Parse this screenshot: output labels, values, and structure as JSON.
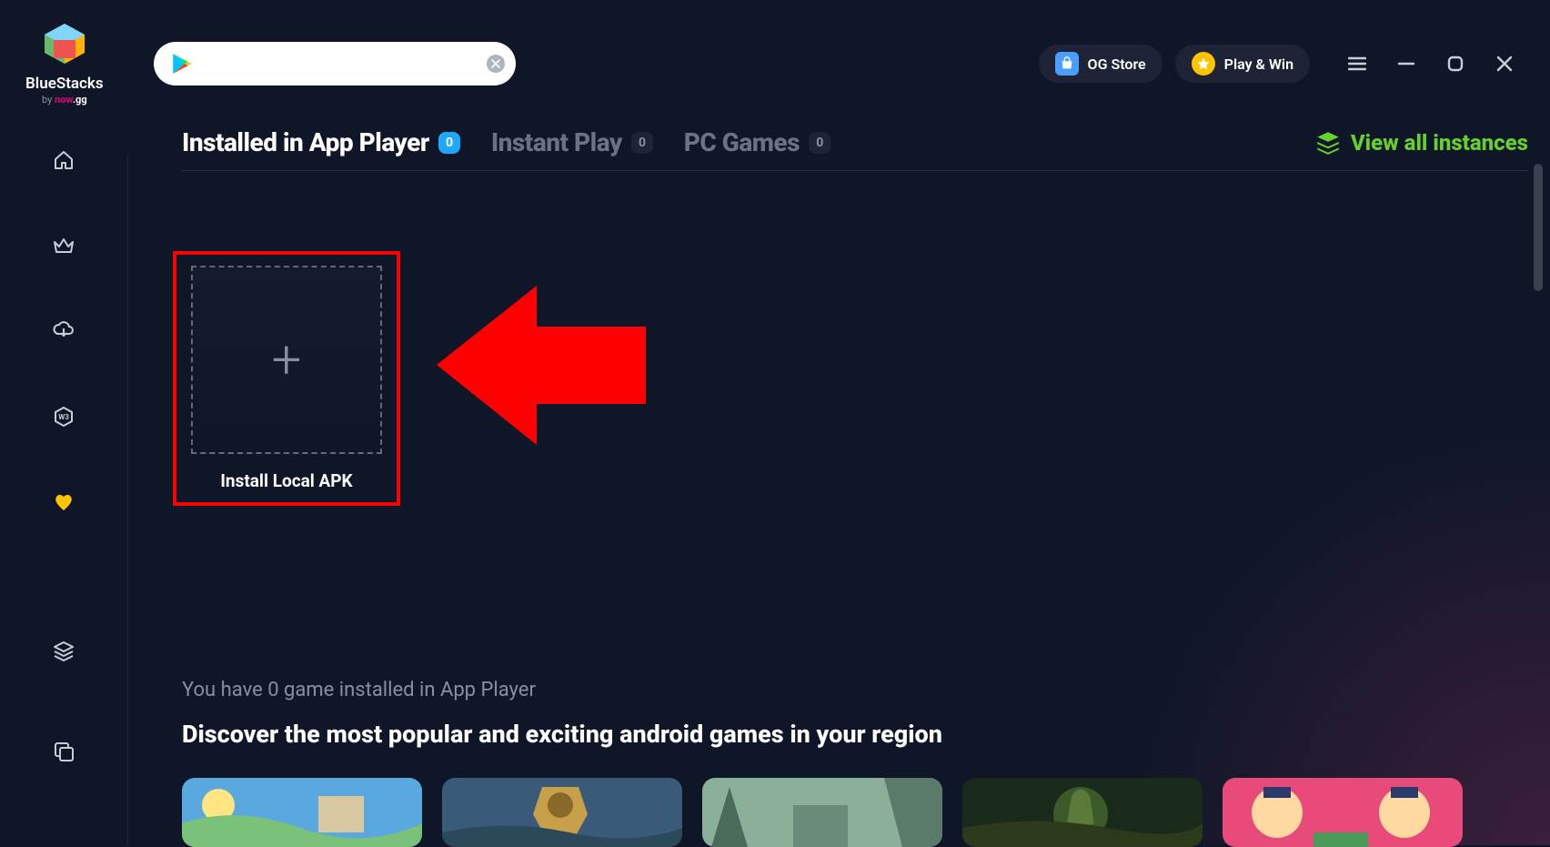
{
  "header": {
    "logo_text": "BlueStacks",
    "logo_by": "by ",
    "logo_now": "now",
    "logo_gg": ".gg",
    "og_store": "OG Store",
    "play_win": "Play & Win"
  },
  "tabs": {
    "installed": {
      "label": "Installed in App Player",
      "count": "0"
    },
    "instant": {
      "label": "Instant Play",
      "count": "0"
    },
    "pc": {
      "label": "PC Games",
      "count": "0"
    }
  },
  "view_instances": "View all instances",
  "apk": {
    "label": "Install Local APK"
  },
  "bottom": {
    "count_text": "You have 0 game installed in App Player",
    "discover": "Discover the most popular and exciting android games in your region"
  }
}
